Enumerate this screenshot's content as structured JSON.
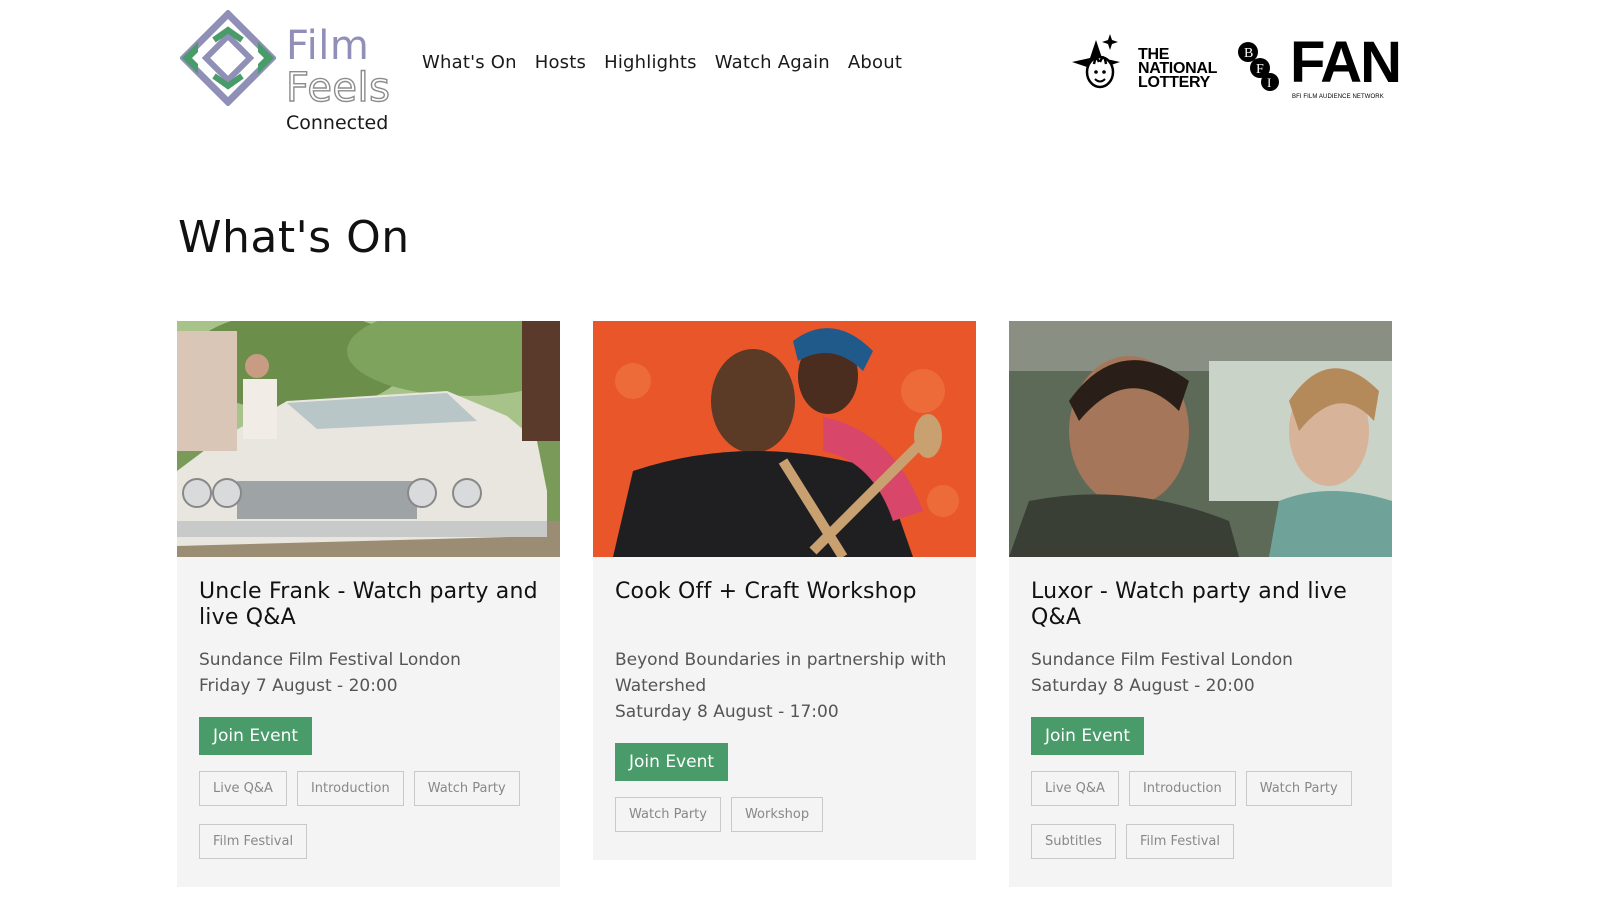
{
  "brand": {
    "logo_film": "Film",
    "logo_feels": "Feels",
    "logo_connected": "Connected"
  },
  "nav": {
    "items": [
      {
        "label": "What's On"
      },
      {
        "label": "Hosts"
      },
      {
        "label": "Highlights"
      },
      {
        "label": "Watch Again"
      },
      {
        "label": "About"
      }
    ]
  },
  "partners": {
    "lottery_line1": "THE",
    "lottery_line2": "NATIONAL",
    "lottery_line3": "LOTTERY",
    "fan_logo": "FAN",
    "fan_subtitle": "BFI FILM AUDIENCE NETWORK"
  },
  "page": {
    "title": "What's On"
  },
  "colors": {
    "accent_green": "#4a9b6a",
    "logo_purple": "#8f8fb8",
    "logo_green": "#4a9b6a",
    "card_bg": "#f4f4f4"
  },
  "events": [
    {
      "title": "Uncle Frank - Watch party and live Q&A",
      "meta_line1": "Sundance Film Festival London",
      "meta_line2": "Friday 7 August - 20:00",
      "button": "Join Event",
      "tags": [
        "Live Q&A",
        "Introduction",
        "Watch Party",
        "Film Festival"
      ]
    },
    {
      "title": "Cook Off + Craft Workshop",
      "meta_line1": "Beyond Boundaries in partnership with Watershed",
      "meta_line2": "Saturday 8 August - 17:00",
      "button": "Join Event",
      "tags": [
        "Watch Party",
        "Workshop"
      ]
    },
    {
      "title": "Luxor - Watch party and live Q&A",
      "meta_line1": "Sundance Film Festival London",
      "meta_line2": "Saturday 8 August - 20:00",
      "button": "Join Event",
      "tags": [
        "Live Q&A",
        "Introduction",
        "Watch Party",
        "Subtitles",
        "Film Festival"
      ]
    }
  ]
}
